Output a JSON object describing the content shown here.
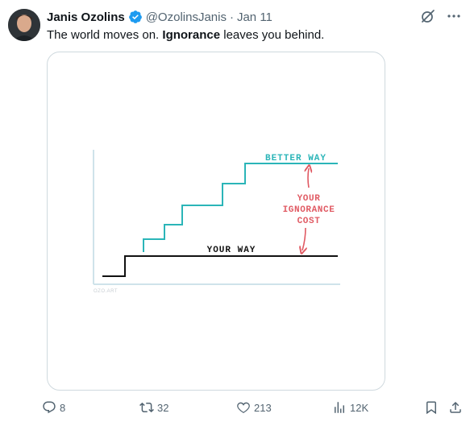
{
  "tweet": {
    "author_name": "Janis Ozolins",
    "handle": "@OzolinsJanis",
    "separator": "·",
    "date": "Jan 11",
    "text_before": "The world moves on. ",
    "text_bold": "Ignorance",
    "text_after": " leaves you behind."
  },
  "media": {
    "label_better": "BETTER WAY",
    "label_cost_line1": "YOUR",
    "label_cost_line2": "IGNORANCE",
    "label_cost_line3": "COST",
    "label_yours": "YOUR WAY",
    "watermark": "OZO.ART"
  },
  "actions": {
    "replies": "8",
    "reposts": "32",
    "likes": "213",
    "views": "12K"
  },
  "colors": {
    "teal": "#2bb5b8",
    "red": "#e05a63",
    "axis": "#cfe3ea",
    "verified": "#1d9bf0"
  },
  "icons": [
    "avatar",
    "verified-badge-icon",
    "grok-icon",
    "more-icon",
    "reply-icon",
    "repost-icon",
    "like-icon",
    "views-icon",
    "bookmark-icon",
    "share-icon"
  ]
}
